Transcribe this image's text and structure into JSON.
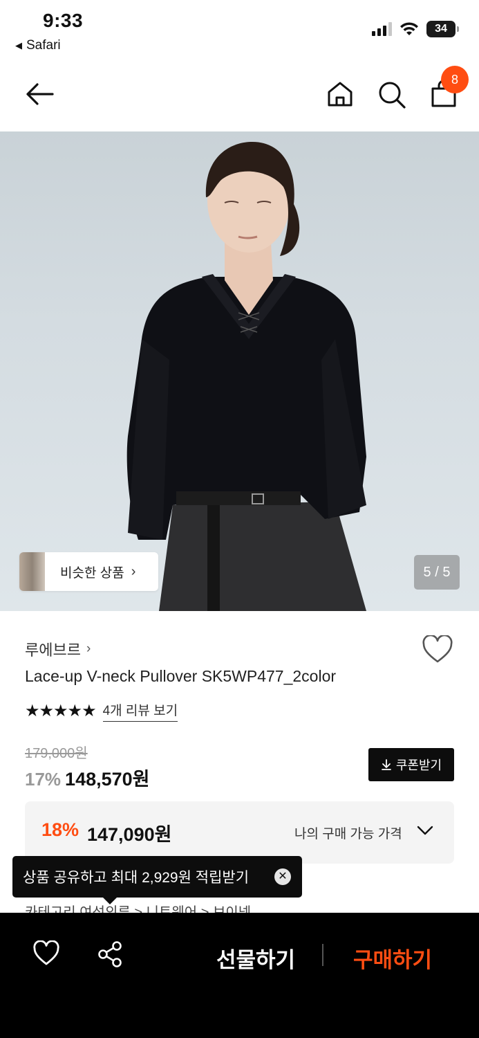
{
  "status_bar": {
    "time": "9:33",
    "back_app": "Safari",
    "battery": "34"
  },
  "nav": {
    "cart_count": "8"
  },
  "hero": {
    "similar_label": "비슷한 상품",
    "pager": "5 / 5"
  },
  "product": {
    "brand": "루에브르",
    "title": "Lace-up V-neck Pullover SK5WP477_2color",
    "stars": "★★★★★",
    "review_link": "4개 리뷰 보기",
    "original_price": "179,000원",
    "discount_pct": "17%",
    "sale_price": "148,570원",
    "coupon_label": "쿠폰받기"
  },
  "my_price": {
    "pct": "18%",
    "price": "147,090원",
    "label": "나의 구매 가능 가격"
  },
  "tooltip": {
    "text": "상품 공유하고 최대 2,929원 적립받기"
  },
  "breadcrumb": "카테고리      여성의류  >  니트웨어  >  브이넥",
  "bottom_bar": {
    "gift": "선물하기",
    "buy": "구매하기"
  },
  "colors": {
    "accent": "#ff4d12",
    "dark": "#0d0d0d",
    "box": "#f4f4f4"
  }
}
